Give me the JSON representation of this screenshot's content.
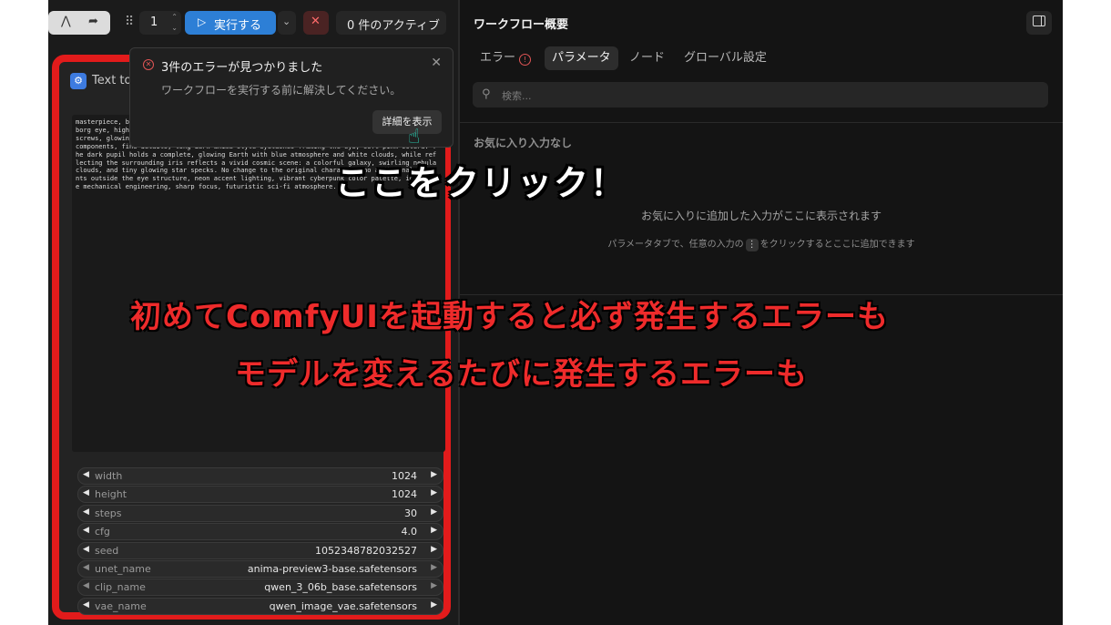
{
  "toolbar": {
    "tool_icons": [
      "connector-icon",
      "redo-icon"
    ],
    "batch_count": "1",
    "run_label": "実行する",
    "active_label": "0 件のアクティブ"
  },
  "node": {
    "title": "Text to I",
    "prompt": "masterpiece, best quality, extreme close-up of a single mechanical eye, original character, cyborg eye, highly detailed metallic cybernetic eyelid and chrome plating, chrome surface, micro screws, glowing cyan circuitry, panel seams wrapped around the eye socket, precise mechanical components, fine details, long dark anime-style eyelashes framing the eye, soft pink sclera. The dark pupil holds a complete, glowing Earth with blue atmosphere and white clouds, while reflecting the surrounding iris reflects a vivid cosmic scene: a colorful galaxy, swirling nebula clouds, and tiny glowing star specks. No change to the original character, no additional elements outside the eye structure, neon accent lighting, vibrant cyberpunk color palette, intricate mechanical engineering, sharp focus, futuristic sci-fi atmosphere.",
    "widgets": [
      {
        "name": "width",
        "value": "1024",
        "kind": "number"
      },
      {
        "name": "height",
        "value": "1024",
        "kind": "number"
      },
      {
        "name": "steps",
        "value": "30",
        "kind": "number"
      },
      {
        "name": "cfg",
        "value": "4.0",
        "kind": "number"
      },
      {
        "name": "seed",
        "value": "1052348782032527",
        "kind": "number"
      },
      {
        "name": "unet_name",
        "value": "anima-preview3-base.safetensors",
        "kind": "combo"
      },
      {
        "name": "clip_name",
        "value": "qwen_3_06b_base.safetensors",
        "kind": "combo"
      },
      {
        "name": "vae_name",
        "value": "qwen_image_vae.safetensors",
        "kind": "number"
      }
    ]
  },
  "error_popup": {
    "title": "3件のエラーが見つかりました",
    "description": "ワークフローを実行する前に解決してください。",
    "details_button": "詳細を表示"
  },
  "panel": {
    "title": "ワークフロー概要",
    "tabs": [
      {
        "label": "エラー",
        "has_error_icon": true
      },
      {
        "label": "パラメータ",
        "active": true
      },
      {
        "label": "ノード"
      },
      {
        "label": "グローバル設定"
      }
    ],
    "search_placeholder": "検索...",
    "favorites_heading": "お気に入り入力なし",
    "favorites_empty": "お気に入りに追加した入力がここに表示されます",
    "favorites_hint_before": "パラメータタブで、任意の入力の",
    "favorites_hint_after": "をクリックするとここに追加できます"
  },
  "captions": {
    "click_here": "ここをクリック！",
    "line1": "初めてComfyUIを起動すると必ず発生するエラーも",
    "line2": "モデルを変えるたびに発生するエラーも"
  },
  "colors": {
    "accent_blue": "#2d7fd6",
    "node_border_red": "#e21b1b",
    "caption_red": "#ee2b2b",
    "cursor_teal": "#2ad5b8",
    "error_red": "#e05555"
  }
}
